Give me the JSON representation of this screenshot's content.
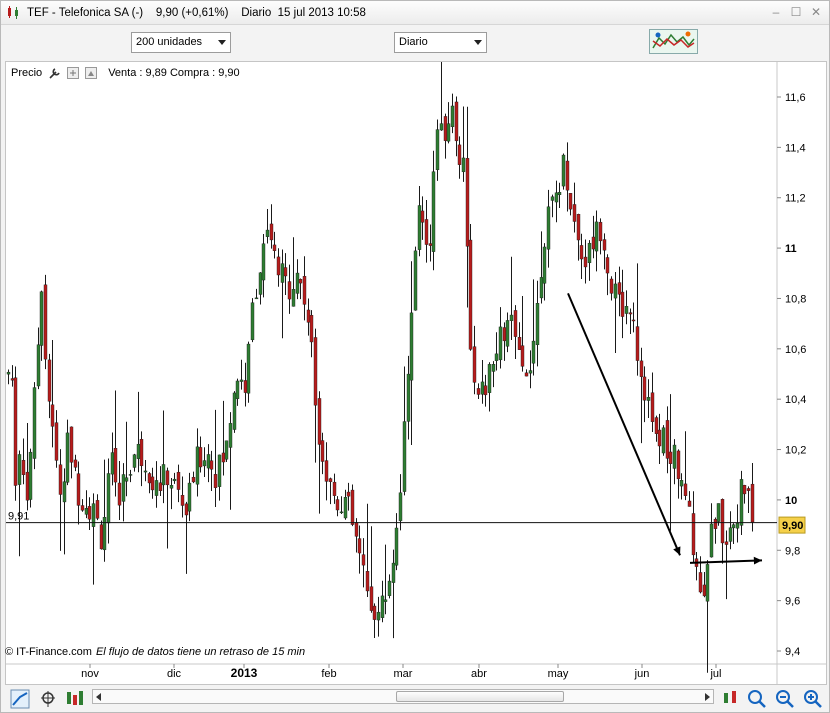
{
  "window": {
    "title": "TEF - Telefonica SA (-)    9,90 (+0,61%)    Diario  15 jul 2013 10:58",
    "controls": [
      "–",
      "☐",
      "✕"
    ]
  },
  "toolbar": {
    "units_select": "200 unidades",
    "period_select": "Diario"
  },
  "chart_header": {
    "label": "Precio",
    "quote": "Venta : 9,89 Compra : 9,90"
  },
  "footer": {
    "copyright": "© IT-Finance.com",
    "delay_notice": "El flujo de datos tiene un retraso de 15 min"
  },
  "colors": {
    "up": "#2e7d32",
    "down": "#b71c1c",
    "price_badge": "#f5d04a"
  },
  "chart_data": {
    "type": "candlestick",
    "y_ticks": [
      "11,6",
      "11,4",
      "11,2",
      "11",
      "10,8",
      "10,6",
      "10,4",
      "10,2",
      "10",
      "9,8",
      "9,6",
      "9,4"
    ],
    "y_values": [
      11.6,
      11.4,
      11.2,
      11.0,
      10.8,
      10.6,
      10.4,
      10.2,
      10.0,
      9.8,
      9.6,
      9.4
    ],
    "ylim": [
      9.37,
      11.68
    ],
    "x_labels": [
      {
        "t": "nov",
        "x": 88
      },
      {
        "t": "dic",
        "x": 172
      },
      {
        "t": "2013",
        "x": 242,
        "bold": true
      },
      {
        "t": "feb",
        "x": 327
      },
      {
        "t": "mar",
        "x": 401
      },
      {
        "t": "abr",
        "x": 477
      },
      {
        "t": "may",
        "x": 556
      },
      {
        "t": "jun",
        "x": 640
      },
      {
        "t": "jul",
        "x": 714
      }
    ],
    "hline_value": 9.91,
    "hline_label": "9,91",
    "last_price": 9.9,
    "last_price_label": "9,90",
    "anchors": [
      [
        0,
        10.4
      ],
      [
        4,
        10.6
      ],
      [
        9,
        10.1
      ],
      [
        14,
        10.2
      ],
      [
        20,
        10.0
      ],
      [
        30,
        10.5
      ],
      [
        35,
        10.9
      ],
      [
        40,
        10.5
      ],
      [
        48,
        10.2
      ],
      [
        55,
        10.0
      ],
      [
        62,
        10.25
      ],
      [
        70,
        10.05
      ],
      [
        78,
        10.0
      ],
      [
        88,
        9.95
      ],
      [
        95,
        9.85
      ],
      [
        105,
        10.15
      ],
      [
        110,
        10.0
      ],
      [
        120,
        10.1
      ],
      [
        130,
        10.2
      ],
      [
        140,
        10.15
      ],
      [
        150,
        10.05
      ],
      [
        160,
        10.1
      ],
      [
        170,
        10.05
      ],
      [
        180,
        9.95
      ],
      [
        190,
        10.15
      ],
      [
        200,
        10.2
      ],
      [
        210,
        10.1
      ],
      [
        220,
        10.2
      ],
      [
        226,
        10.4
      ],
      [
        230,
        10.5
      ],
      [
        240,
        10.45
      ],
      [
        247,
        10.8
      ],
      [
        255,
        10.95
      ],
      [
        262,
        11.05
      ],
      [
        272,
        10.9
      ],
      [
        282,
        10.85
      ],
      [
        292,
        10.9
      ],
      [
        298,
        10.8
      ],
      [
        303,
        10.7
      ],
      [
        310,
        10.35
      ],
      [
        320,
        10.1
      ],
      [
        330,
        10.0
      ],
      [
        340,
        10.0
      ],
      [
        346,
        9.9
      ],
      [
        352,
        9.8
      ],
      [
        362,
        9.6
      ],
      [
        372,
        9.55
      ],
      [
        378,
        9.6
      ],
      [
        386,
        9.75
      ],
      [
        392,
        9.95
      ],
      [
        398,
        10.3
      ],
      [
        404,
        10.65
      ],
      [
        408,
        10.85
      ],
      [
        412,
        11.2
      ],
      [
        418,
        11.1
      ],
      [
        423,
        11.0
      ],
      [
        428,
        11.3
      ],
      [
        432,
        11.55
      ],
      [
        436,
        11.4
      ],
      [
        440,
        11.5
      ],
      [
        446,
        11.55
      ],
      [
        452,
        11.35
      ],
      [
        458,
        11.4
      ],
      [
        462,
        10.8
      ],
      [
        466,
        10.55
      ],
      [
        470,
        10.35
      ],
      [
        478,
        10.45
      ],
      [
        485,
        10.5
      ],
      [
        495,
        10.65
      ],
      [
        505,
        10.7
      ],
      [
        512,
        10.55
      ],
      [
        518,
        10.5
      ],
      [
        526,
        10.6
      ],
      [
        532,
        10.8
      ],
      [
        536,
        11.0
      ],
      [
        540,
        11.1
      ],
      [
        546,
        11.15
      ],
      [
        552,
        11.25
      ],
      [
        558,
        11.35
      ],
      [
        562,
        11.25
      ],
      [
        568,
        11.1
      ],
      [
        574,
        11.0
      ],
      [
        580,
        10.95
      ],
      [
        588,
        11.05
      ],
      [
        596,
        11.1
      ],
      [
        602,
        10.9
      ],
      [
        610,
        10.8
      ],
      [
        618,
        10.75
      ],
      [
        626,
        10.8
      ],
      [
        632,
        10.55
      ],
      [
        638,
        10.45
      ],
      [
        644,
        10.35
      ],
      [
        650,
        10.2
      ],
      [
        656,
        10.3
      ],
      [
        662,
        10.1
      ],
      [
        668,
        10.2
      ],
      [
        674,
        10.05
      ],
      [
        680,
        10.0
      ],
      [
        686,
        9.85
      ],
      [
        692,
        9.7
      ],
      [
        696,
        9.6
      ],
      [
        700,
        9.75
      ],
      [
        706,
        9.9
      ],
      [
        712,
        9.95
      ],
      [
        718,
        9.85
      ],
      [
        724,
        9.9
      ],
      [
        730,
        9.95
      ],
      [
        736,
        10.05
      ],
      [
        742,
        10.0
      ],
      [
        748,
        9.88
      ],
      [
        750,
        9.9
      ]
    ],
    "annotations": [
      {
        "from": [
          566,
          10.82
        ],
        "to": [
          678,
          9.78
        ]
      },
      {
        "from": [
          688,
          9.75
        ],
        "to": [
          760,
          9.76
        ]
      }
    ]
  }
}
